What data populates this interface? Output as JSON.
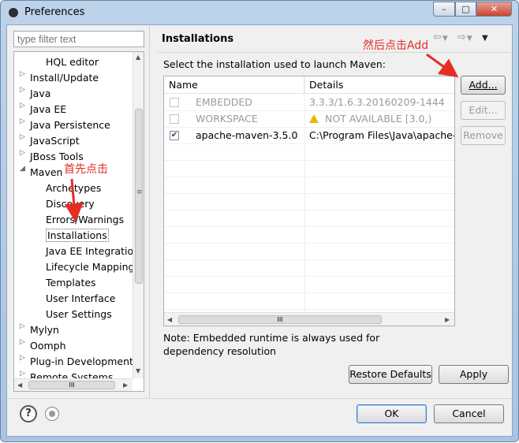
{
  "window": {
    "title": "Preferences",
    "min_glyph": "–",
    "max_glyph": "□",
    "close_glyph": "✕"
  },
  "filter": {
    "placeholder": "type filter text"
  },
  "tree": {
    "items": [
      {
        "label": "HQL editor",
        "level": 1,
        "twisty": ""
      },
      {
        "label": "Install/Update",
        "level": 0,
        "twisty": "▷"
      },
      {
        "label": "Java",
        "level": 0,
        "twisty": "▷"
      },
      {
        "label": "Java EE",
        "level": 0,
        "twisty": "▷"
      },
      {
        "label": "Java Persistence",
        "level": 0,
        "twisty": "▷"
      },
      {
        "label": "JavaScript",
        "level": 0,
        "twisty": "▷"
      },
      {
        "label": "JBoss Tools",
        "level": 0,
        "twisty": "▷"
      },
      {
        "label": "Maven",
        "level": 0,
        "twisty": "◢"
      },
      {
        "label": "Archetypes",
        "level": 1,
        "twisty": ""
      },
      {
        "label": "Discovery",
        "level": 1,
        "twisty": ""
      },
      {
        "label": "Errors/Warnings",
        "level": 1,
        "twisty": ""
      },
      {
        "label": "Installations",
        "level": 1,
        "twisty": "",
        "selected": true
      },
      {
        "label": "Java EE Integration",
        "level": 1,
        "twisty": ""
      },
      {
        "label": "Lifecycle Mappings",
        "level": 1,
        "twisty": ""
      },
      {
        "label": "Templates",
        "level": 1,
        "twisty": ""
      },
      {
        "label": "User Interface",
        "level": 1,
        "twisty": ""
      },
      {
        "label": "User Settings",
        "level": 1,
        "twisty": ""
      },
      {
        "label": "Mylyn",
        "level": 0,
        "twisty": "▷"
      },
      {
        "label": "Oomph",
        "level": 0,
        "twisty": "▷"
      },
      {
        "label": "Plug-in Development",
        "level": 0,
        "twisty": "▷"
      },
      {
        "label": "Remote Systems",
        "level": 0,
        "twisty": "▷"
      }
    ],
    "scroll_glyph": "≡",
    "hscroll_glyph": "III"
  },
  "page": {
    "title": "Installations",
    "description": "Select the installation used to launch Maven:",
    "note": "Note: Embedded runtime is always used for dependency resolution"
  },
  "table": {
    "columns": [
      "Name",
      "Details"
    ],
    "rows": [
      {
        "checked": false,
        "enabled": false,
        "name": "EMBEDDED",
        "details": "3.3.3/1.6.3.20160209-1444",
        "warning": false
      },
      {
        "checked": false,
        "enabled": false,
        "name": "WORKSPACE",
        "details": "NOT AVAILABLE [3.0,)",
        "warning": true
      },
      {
        "checked": true,
        "enabled": true,
        "name": "apache-maven-3.5.0",
        "details": "C:\\Program Files\\Java\\apache-maven",
        "warning": false
      }
    ],
    "hscroll_glyph": "III"
  },
  "buttons": {
    "add": "Add...",
    "edit": "Edit...",
    "remove": "Remove",
    "restore_defaults": "Restore Defaults",
    "apply": "Apply",
    "ok": "OK",
    "cancel": "Cancel"
  },
  "annotations": {
    "first_click": "首先点击",
    "then_click": "然后点击Add",
    "color": "#e52d24"
  },
  "icons": [
    "app-icon",
    "help-icon",
    "record-icon",
    "warning-icon",
    "back-arrow-icon",
    "forward-arrow-icon",
    "view-menu-icon"
  ]
}
